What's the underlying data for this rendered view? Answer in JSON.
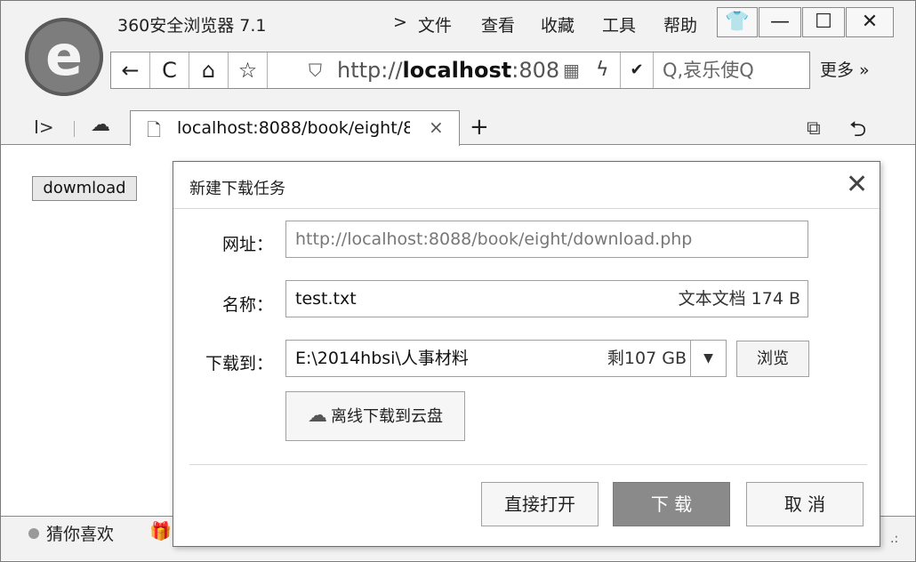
{
  "browser": {
    "app_title": "360安全浏览器 7.1",
    "logo_icon": "360-browser-logo-icon",
    "menu": {
      "arrow": ">",
      "file": "文件",
      "view": "查看",
      "favorites": "收藏",
      "tools": "工具",
      "help": "帮助"
    },
    "window_buttons": {
      "skin": "👕",
      "minimize": "—",
      "maximize": "☐",
      "close": "✕"
    },
    "nav": {
      "back": "←",
      "reload": "C",
      "home": "⌂",
      "favorite": "☆",
      "shield": "⛉",
      "url_prefix": "http://",
      "url_host": "localhost",
      "url_rest": ":808",
      "qr": "▦",
      "flash": "ϟ",
      "dropdown": "✔",
      "search": "Q,哀乐使Q",
      "more": "更多 »"
    },
    "tabs": {
      "sidebar_toggle": "I>",
      "cloud": "☁",
      "active_tab_title": "localhost:8088/book/eight/8",
      "tab_close": "×",
      "new_tab": "+",
      "tabs_menu": "⧉",
      "undo": "⮌"
    }
  },
  "page": {
    "download_button": "dowmload"
  },
  "status": {
    "guess": "猜你喜欢",
    "gift": "🎁",
    "grip": ".:"
  },
  "dialog": {
    "title": "新建下载任务",
    "close": "✕",
    "url_label": "网址：",
    "url_value": "http://localhost:8088/book/eight/download.php",
    "name_label": "名称：",
    "name_value": "test.txt",
    "name_type": "文本文档 174 B",
    "saveto_label": "下载到：",
    "path_value": "E:\\2014hbsi\\人事材料",
    "path_free": "剩107 GB",
    "path_dropdown": "▼",
    "browse": "浏览",
    "cloud_icon": "☁",
    "cloud_button": "离线下载到云盘",
    "open_button": "直接打开",
    "download_button": "下 载",
    "cancel_button": "取 消"
  }
}
